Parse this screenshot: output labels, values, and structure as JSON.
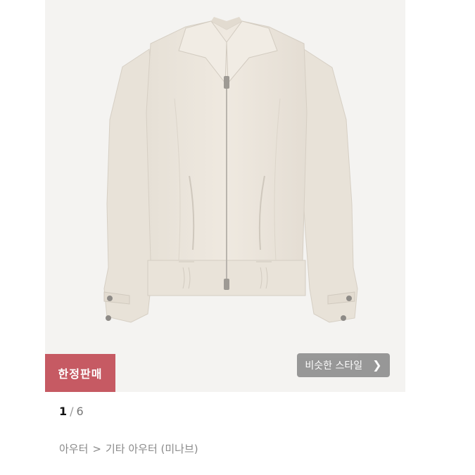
{
  "product": {
    "image_alt": "Ivory zip-up collared jacket",
    "badge_label": "한정판매",
    "similar_style_label": "비슷한 스타일",
    "similar_style_icon": "chevron-right-icon"
  },
  "pager": {
    "current": "1",
    "separator": "/",
    "total": "6"
  },
  "breadcrumb": {
    "items": [
      "아우터",
      "기타 아우터 (미나브)"
    ],
    "separator": ">"
  },
  "colors": {
    "badge_bg": "#c65a63",
    "jacket": "#ece6dc",
    "background": "#f4f3f1"
  }
}
